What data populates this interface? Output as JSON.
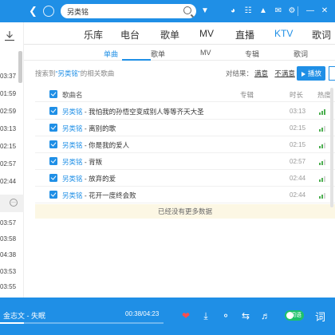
{
  "topbar": {
    "search_value": "另类铭",
    "icons": [
      "back-icon",
      "refresh-icon",
      "search-icon",
      "dropdown-icon",
      "radio-icon",
      "game-icon",
      "skin-icon",
      "settings-icon",
      "minimize-icon",
      "close-icon"
    ]
  },
  "left": {
    "times": [
      "03:37",
      "01:59",
      "02:59",
      "03:13",
      "02:15",
      "02:57",
      "02:44",
      "03:57",
      "03:58",
      "04:38",
      "03:53",
      "03:55"
    ]
  },
  "nav": {
    "tabs": [
      "乐库",
      "电台",
      "歌单",
      "MV",
      "直播",
      "KTV",
      "歌词"
    ],
    "active": "KTV"
  },
  "subnav": {
    "tabs": [
      "单曲",
      "歌单",
      "MV",
      "专辑",
      "歌词"
    ],
    "active": "单曲"
  },
  "info": {
    "prefix": "搜索到",
    "keyword": "“另类铭”",
    "suffix": "的相关歌曲",
    "feedback_label": "对结果：",
    "satisfied": "满意",
    "unsatisfied": "不满意",
    "play_label": "播放"
  },
  "table": {
    "headers": {
      "name": "歌曲名",
      "album": "专辑",
      "duration": "时长",
      "hot": "热度"
    },
    "rows": [
      {
        "singer": "另类铭",
        "song": "我怕我的孙悟空变成别人等等齐天大圣",
        "duration": "03:13",
        "hot": 3
      },
      {
        "singer": "另类铭",
        "song": "离别的歌",
        "duration": "02:15",
        "hot": 2
      },
      {
        "singer": "另类铭",
        "song": "你是我的爱人",
        "duration": "02:15",
        "hot": 2
      },
      {
        "singer": "另类铭",
        "song": "背叛",
        "duration": "02:57",
        "hot": 2
      },
      {
        "singer": "另类铭",
        "song": "放弃的爱",
        "duration": "02:44",
        "hot": 2
      },
      {
        "singer": "另类铭",
        "song": "花开一度终会败",
        "duration": "02:44",
        "hot": 2
      }
    ],
    "no_more": "已经没有更多数据"
  },
  "player": {
    "title": "金志文 - 失眠",
    "time": "00:38/04:23",
    "progress": 0.145,
    "lyric_toggle": "词语",
    "lyric_label": "词"
  },
  "colors": {
    "accent": "#1f8fe6",
    "heart": "#ff4d4d",
    "toggle": "#1ec26a"
  }
}
